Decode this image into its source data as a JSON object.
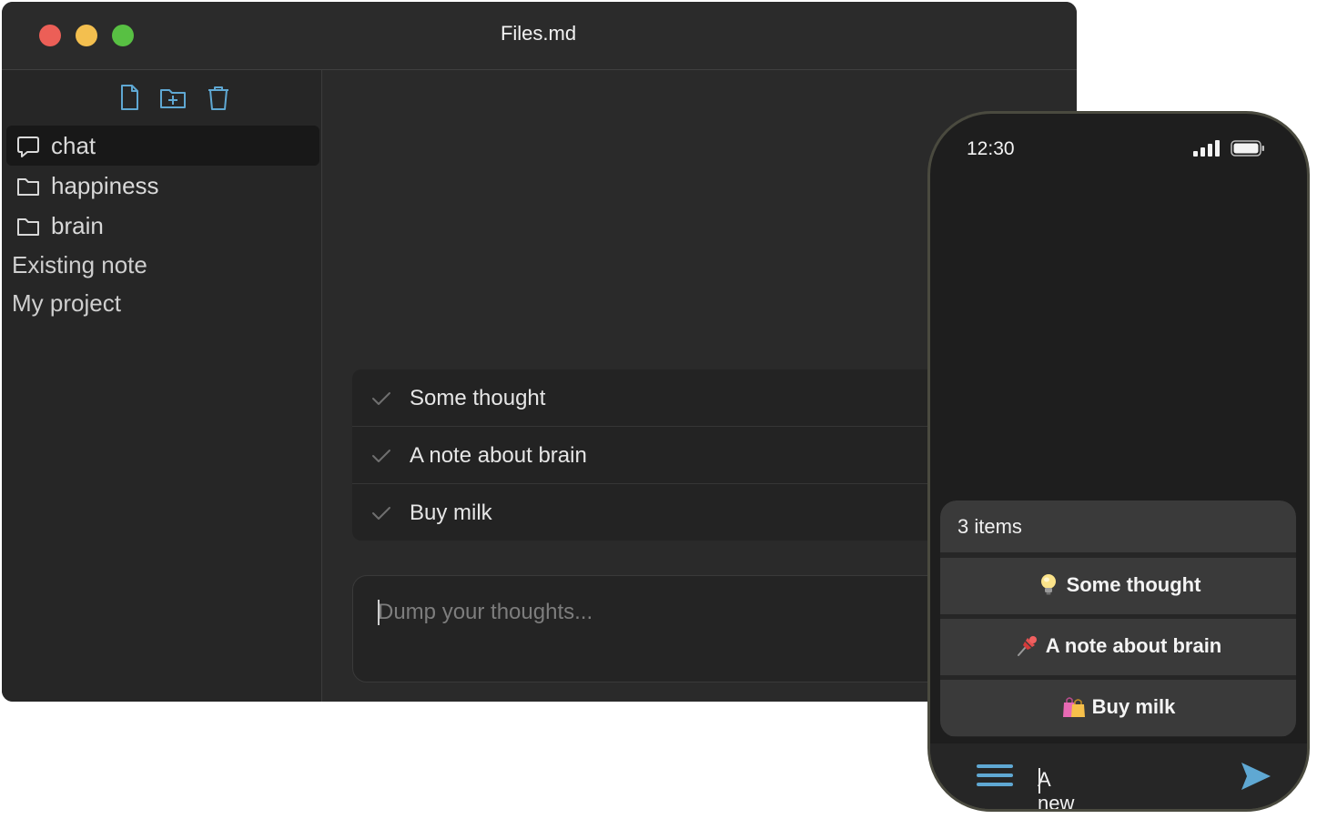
{
  "window": {
    "title": "Files.md"
  },
  "sidebar": {
    "toolbar": {
      "new_file_icon": "file-icon",
      "new_folder_icon": "folder-plus-icon",
      "delete_icon": "trash-icon"
    },
    "folders": [
      {
        "label": "chat",
        "icon": "chat-bubble-icon",
        "selected": true
      },
      {
        "label": "happiness",
        "icon": "folder-icon",
        "selected": false
      },
      {
        "label": "brain",
        "icon": "folder-icon",
        "selected": false
      }
    ],
    "notes": [
      {
        "label": "Existing note"
      },
      {
        "label": "My project"
      }
    ]
  },
  "main": {
    "entries": [
      {
        "text": "Some thought"
      },
      {
        "text": "A note about brain"
      },
      {
        "text": "Buy milk"
      }
    ],
    "composer": {
      "placeholder": "Dump your thoughts..."
    }
  },
  "phone": {
    "status": {
      "time": "12:30"
    },
    "list": {
      "count_label": "3 items",
      "items": [
        {
          "emoji": "lightbulb-icon",
          "text": "Some thought"
        },
        {
          "emoji": "pushpin-icon",
          "text": "A note about brain"
        },
        {
          "emoji": "shopping-bags-icon",
          "text": "Buy milk"
        }
      ]
    },
    "input": {
      "value": "A new note"
    }
  },
  "colors": {
    "accent": "#5fa8d3",
    "window_bg": "#292929",
    "sidebar_bg": "#262626",
    "phone_bg": "#1e1e1e"
  }
}
